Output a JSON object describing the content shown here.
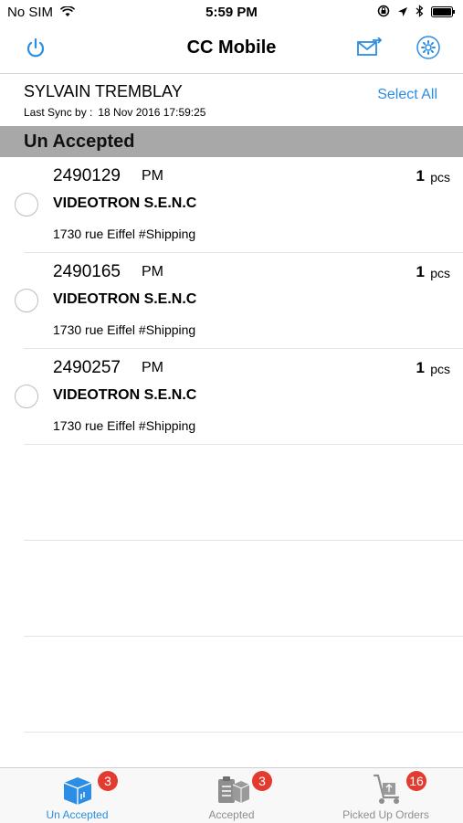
{
  "status_bar": {
    "carrier": "No SIM",
    "time": "5:59 PM"
  },
  "nav": {
    "title": "CC Mobile"
  },
  "user": {
    "name": "SYLVAIN TREMBLAY",
    "sync_label": "Last Sync by :",
    "sync_value": "18 Nov 2016 17:59:25",
    "select_all": "Select All"
  },
  "section": {
    "title": "Un Accepted"
  },
  "orders": [
    {
      "number": "2490129",
      "period": "PM",
      "qty": "1",
      "unit": "pcs",
      "company": "VIDEOTRON S.E.N.C",
      "address": "1730 rue Eiffel #Shipping"
    },
    {
      "number": "2490165",
      "period": "PM",
      "qty": "1",
      "unit": "pcs",
      "company": "VIDEOTRON S.E.N.C",
      "address": "1730 rue Eiffel #Shipping"
    },
    {
      "number": "2490257",
      "period": "PM",
      "qty": "1",
      "unit": "pcs",
      "company": "VIDEOTRON S.E.N.C",
      "address": "1730 rue Eiffel #Shipping"
    }
  ],
  "tabs": [
    {
      "label": "Un Accepted",
      "badge": "3",
      "icon": "boxes-icon",
      "active": true
    },
    {
      "label": "Accepted",
      "badge": "3",
      "icon": "clipboard-box-icon",
      "active": false
    },
    {
      "label": "Picked Up Orders",
      "badge": "16",
      "icon": "hand-truck-icon",
      "active": false
    }
  ],
  "colors": {
    "accent": "#2b8de3",
    "section_bg": "#a8a8a8",
    "badge": "#e23b30"
  }
}
